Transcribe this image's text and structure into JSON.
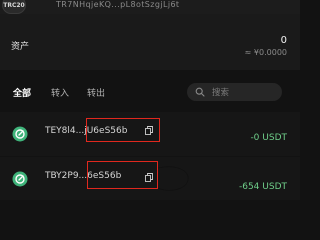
{
  "account": {
    "token_badge": "TRC20",
    "address": "TR7NHqjeKQ...pL8otSzgjLj6t"
  },
  "asset": {
    "label": "资产",
    "amount": "0",
    "fiat_value": "≈ ¥0.0000"
  },
  "tabs": [
    {
      "label": "全部",
      "active": true
    },
    {
      "label": "转入",
      "active": false
    },
    {
      "label": "转出",
      "active": false
    }
  ],
  "search": {
    "placeholder": "搜索"
  },
  "transactions": [
    {
      "address": "TEY8l4...jU6eS56b",
      "amount": "-0 USDT",
      "icon": "status-icon"
    },
    {
      "address": "TBY2P9...6eS56b",
      "amount": "-654 USDT",
      "icon": "status-icon"
    }
  ],
  "colors": {
    "background": "#121212",
    "accent_green": "#6fcf8a",
    "annotation_red": "#e0281e"
  }
}
